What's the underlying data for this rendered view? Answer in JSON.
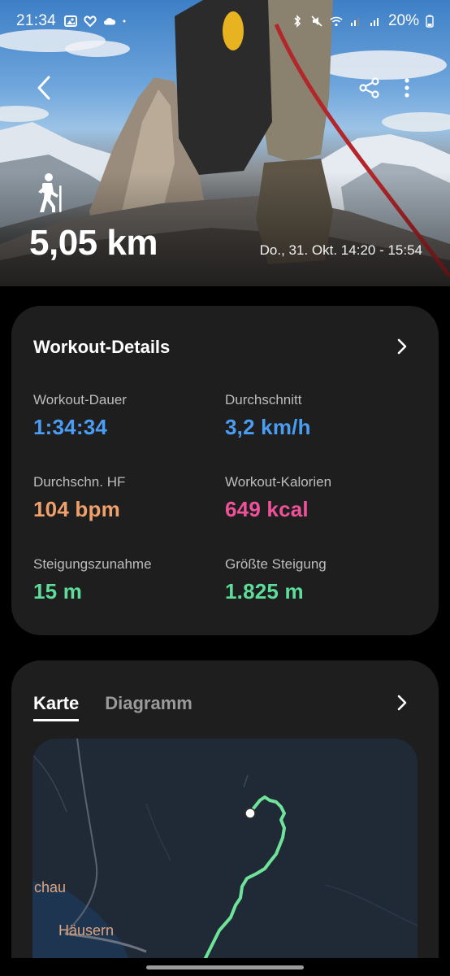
{
  "status_bar": {
    "time": "21:34",
    "battery": "20%"
  },
  "hero": {
    "distance": "5,05 km",
    "date_range": "Do., 31. Okt. 14:20 - 15:54",
    "activity_icon": "hiking-icon"
  },
  "details": {
    "title": "Workout-Details",
    "metrics": [
      {
        "label": "Workout-Dauer",
        "value": "1:34:34",
        "color": "#4a9df5"
      },
      {
        "label": "Durchschnitt",
        "value": "3,2 km/h",
        "color": "#4a9df5"
      },
      {
        "label": "Durchschn. HF",
        "value": "104 bpm",
        "color": "#f0a06a"
      },
      {
        "label": "Workout-Kalorien",
        "value": "649 kcal",
        "color": "#f0529a"
      },
      {
        "label": "Steigungszunahme",
        "value": "15 m",
        "color": "#5ddc9a"
      },
      {
        "label": "Größte Steigung",
        "value": "1.825 m",
        "color": "#5ddc9a"
      }
    ]
  },
  "map_card": {
    "tabs": [
      {
        "label": "Karte",
        "active": true
      },
      {
        "label": "Diagramm",
        "active": false
      }
    ],
    "map_labels": [
      "chau",
      "Häusern"
    ],
    "route_color": "#6fe39a"
  }
}
